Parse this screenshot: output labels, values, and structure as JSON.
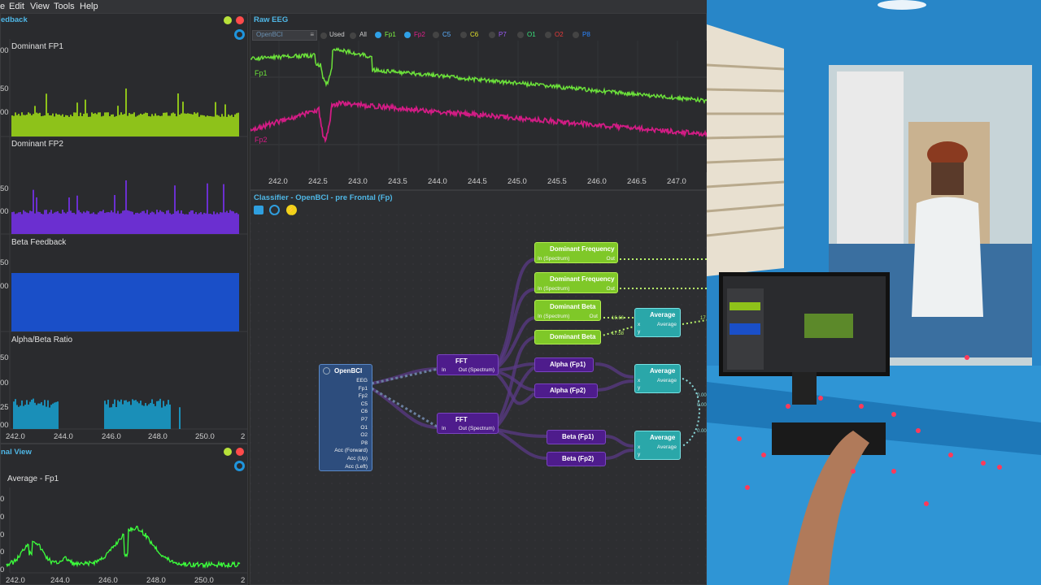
{
  "menu": {
    "file": "e",
    "edit": "Edit",
    "view": "View",
    "tools": "Tools",
    "help": "Help"
  },
  "feedback": {
    "title": "edback",
    "charts": [
      {
        "label": "Dominant FP1",
        "color": "#8ec21a"
      },
      {
        "label": "Dominant FP2",
        "color": "#6b2fd0"
      },
      {
        "label": "Beta  Feedback",
        "color": "#1a4fc8"
      },
      {
        "label": "Alpha/Beta Ratio",
        "color": "#1a8fb8"
      }
    ],
    "ylabels": [
      "00",
      "50",
      "00",
      "50",
      "00",
      "50",
      "00",
      "50",
      "00",
      "25",
      "00"
    ],
    "xaxis": [
      "242.0",
      "244.0",
      "246.0",
      "248.0",
      "250.0",
      "2"
    ]
  },
  "signal": {
    "title": "nal View",
    "label": "Average - Fp1",
    "ylabels": [
      "0",
      "0",
      "0",
      "0",
      "0",
      "0"
    ],
    "xaxis": [
      "242.0",
      "244.0",
      "246.0",
      "248.0",
      "250.0",
      "2"
    ]
  },
  "raw": {
    "title": "Raw EEG",
    "device": "OpenBCI",
    "used": "Used",
    "all": "All",
    "channels": [
      "Fp1",
      "Fp2",
      "C5",
      "C6",
      "P7",
      "O1",
      "O2",
      "P8"
    ],
    "channel_colors": [
      "#7df23f",
      "#e0208a",
      "#5ab0ff",
      "#e0e02a",
      "#9b59f5",
      "#39e07b",
      "#e83a3a",
      "#2a86ff"
    ],
    "trace1": "Fp1",
    "trace2": "Fp2",
    "xaxis": [
      "242.0",
      "242.5",
      "243.0",
      "243.5",
      "244.0",
      "244.5",
      "245.0",
      "245.5",
      "246.0",
      "246.5",
      "247.0"
    ]
  },
  "classifier": {
    "title": "Classifier - OpenBCI - pre Frontal (Fp)",
    "openbci": {
      "title": "OpenBCI",
      "ports": [
        "EEG",
        "Fp1",
        "Fp2",
        "C5",
        "C6",
        "P7",
        "O1",
        "O2",
        "P8",
        "Acc (Forward)",
        "Acc (Up)",
        "Acc (Left)"
      ]
    },
    "fft": {
      "title": "FFT",
      "in": "In",
      "out": "Out (Spectrum)"
    },
    "dominant_frequency": {
      "title": "Dominant Frequency",
      "in": "In (Spectrum)",
      "out": "Out"
    },
    "dominant_beta": {
      "title": "Dominant Beta",
      "in": "In (Spectrum)",
      "out": "Out"
    },
    "alpha_fp1": "Alpha (Fp1)",
    "alpha_fp2": "Alpha (Fp2)",
    "beta_fp1": "Beta (Fp1)",
    "beta_fp2": "Beta (Fp2)",
    "average": {
      "title": "Average",
      "port": "Average",
      "x": "x",
      "y": "y"
    },
    "values": [
      "16.66",
      "17.58",
      "17",
      "0.00",
      "0.00",
      "0.00"
    ]
  },
  "colors": {
    "accent": "#4fb7e6",
    "green_node": "#7fc828",
    "purple_node": "#4e1c8c",
    "teal_node": "#2aa7a9",
    "signal": "#3cff3c"
  }
}
